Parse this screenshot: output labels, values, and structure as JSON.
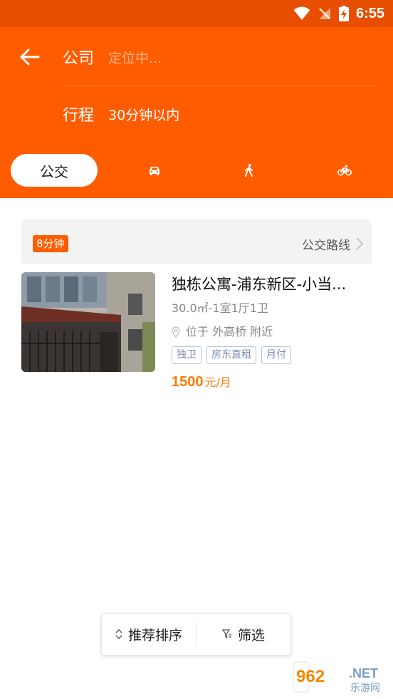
{
  "status_bar": {
    "time": "6:55"
  },
  "header": {
    "company_label": "公司",
    "company_placeholder": "定位中...",
    "trip_label": "行程",
    "trip_value": "30分钟以内"
  },
  "transport_modes": [
    {
      "label": "公交",
      "icon": "bus-icon",
      "selected": true
    },
    {
      "icon": "car-icon",
      "selected": false
    },
    {
      "icon": "walk-icon",
      "selected": false
    },
    {
      "icon": "bicycle-icon",
      "selected": false
    }
  ],
  "route_card": {
    "time_badge": "8分钟",
    "route_link": "公交路线"
  },
  "listing": {
    "title": "独栋公寓-浦东新区-小当...",
    "spec": "30.0㎡-1室1厅1卫",
    "location": "位于 外高桥 附近",
    "tags": [
      "独卫",
      "房东直租",
      "月付"
    ],
    "price": "1500",
    "price_unit": "元/月"
  },
  "bottom_bar": {
    "sort_label": "推荐排序",
    "filter_label": "筛选"
  },
  "watermark": {
    "number": "962",
    "suffix": ".NET",
    "text": "乐游网"
  },
  "colors": {
    "header": "#ff5c00",
    "status_bar": "#e84e00",
    "price": "#ff7a00",
    "tag": "#7d8fb3"
  }
}
